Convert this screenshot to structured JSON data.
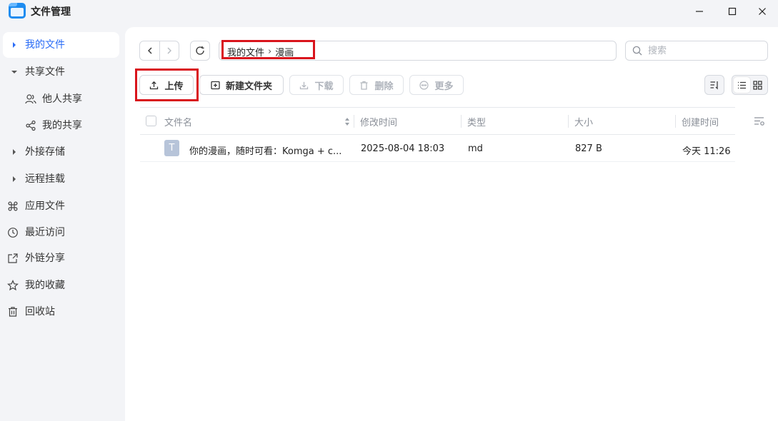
{
  "window": {
    "title": "文件管理"
  },
  "sidebar": {
    "items": [
      {
        "label": "我的文件",
        "icon": "caret-right-icon",
        "active": true
      },
      {
        "label": "共享文件",
        "icon": "caret-down-icon"
      },
      {
        "label": "他人共享",
        "icon": "users-icon"
      },
      {
        "label": "我的共享",
        "icon": "share-icon"
      },
      {
        "label": "外接存储",
        "icon": "caret-right-icon"
      },
      {
        "label": "远程挂载",
        "icon": "caret-right-icon"
      },
      {
        "label": "应用文件",
        "icon": "command-icon"
      },
      {
        "label": "最近访问",
        "icon": "clock-icon"
      },
      {
        "label": "外链分享",
        "icon": "external-share-icon"
      },
      {
        "label": "我的收藏",
        "icon": "star-icon"
      },
      {
        "label": "回收站",
        "icon": "trash-icon"
      }
    ]
  },
  "breadcrumb": [
    "我的文件",
    "漫画"
  ],
  "breadcrumb_separator": "›",
  "search": {
    "placeholder": "搜索",
    "value": ""
  },
  "toolbar": {
    "upload": "上传",
    "new_folder": "新建文件夹",
    "download": "下载",
    "delete": "删除",
    "more": "更多"
  },
  "table": {
    "columns": [
      "文件名",
      "修改时间",
      "类型",
      "大小",
      "创建时间"
    ],
    "rows": [
      {
        "icon_letter": "T",
        "name": "你的漫画，随时可看：Komga + c...",
        "modified": "2025-08-04 18:03",
        "type": "md",
        "size": "827 B",
        "created": "今天 11:26"
      }
    ]
  },
  "colors": {
    "accent": "#2a6cf6",
    "highlight": "#d9141c",
    "sidebar_bg": "#f3f4f7",
    "file_icon": "#b7c4d9"
  }
}
